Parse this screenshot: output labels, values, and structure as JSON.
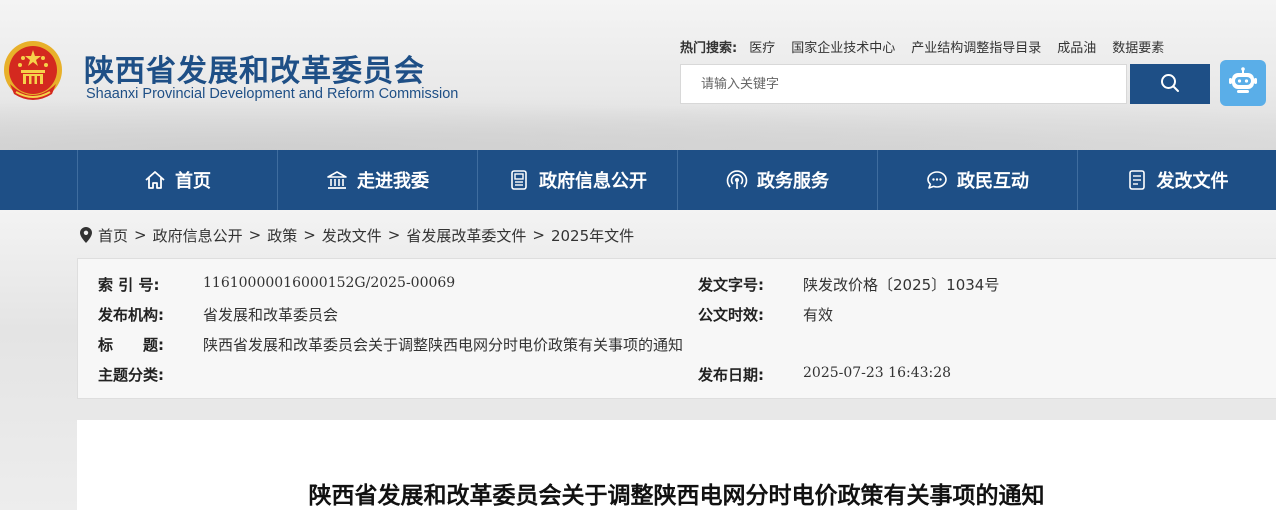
{
  "header": {
    "site_title": "陕西省发展和改革委员会",
    "site_subtitle": "Shaanxi Provincial Development and Reform Commission",
    "hot_search_label": "热门搜索:",
    "hot_search_links": [
      "医疗",
      "国家企业技术中心",
      "产业结构调整指导目录",
      "成品油",
      "数据要素"
    ],
    "search_placeholder": "请输入关键字",
    "colors": {
      "brand": "#1e4f86",
      "robot": "#5aaee8"
    }
  },
  "nav": {
    "items": [
      {
        "label": "首页",
        "icon": "home-icon"
      },
      {
        "label": "走进我委",
        "icon": "building-icon"
      },
      {
        "label": "政府信息公开",
        "icon": "document-icon"
      },
      {
        "label": "政务服务",
        "icon": "signal-icon"
      },
      {
        "label": "政民互动",
        "icon": "chat-icon"
      },
      {
        "label": "发改文件",
        "icon": "file-icon"
      }
    ]
  },
  "breadcrumb": {
    "items": [
      "首页",
      "政府信息公开",
      "政策",
      "发改文件",
      "省发展改革委文件",
      "2025年文件"
    ],
    "separator": ">"
  },
  "meta": {
    "index_label": "索 引 号:",
    "index_value": "11610000016000152G/2025-00069",
    "doc_no_label": "发文字号:",
    "doc_no_value": "陕发改价格〔2025〕1034号",
    "publisher_label": "发布机构:",
    "publisher_value": "省发展和改革委员会",
    "validity_label": "公文时效:",
    "validity_value": "有效",
    "title_label": "标　　题:",
    "title_value": "陕西省发展和改革委员会关于调整陕西电网分时电价政策有关事项的通知",
    "topic_label": "主题分类:",
    "topic_value": "",
    "date_label": "发布日期:",
    "date_value": "2025-07-23 16:43:28"
  },
  "article": {
    "title": "陕西省发展和改革委员会关于调整陕西电网分时电价政策有关事项的通知"
  }
}
